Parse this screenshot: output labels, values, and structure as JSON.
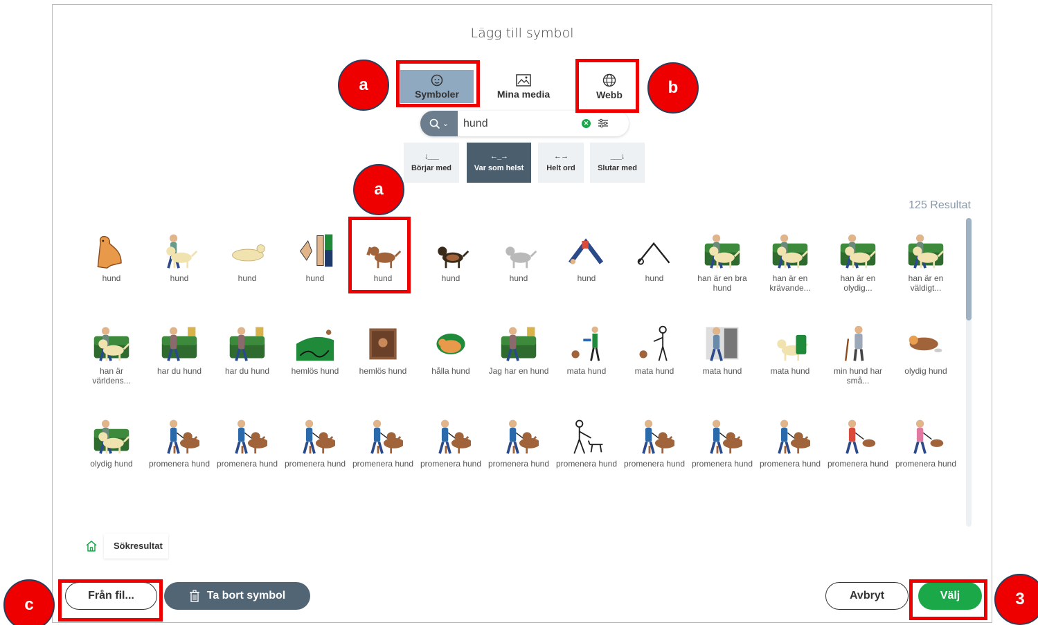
{
  "dialog": {
    "title": "Lägg till symbol"
  },
  "tabs": [
    {
      "label": "Symboler",
      "icon": "face-icon",
      "active": true
    },
    {
      "label": "Mina media",
      "icon": "image-icon",
      "active": false
    },
    {
      "label": "Webb",
      "icon": "globe-icon",
      "active": false
    }
  ],
  "search": {
    "value": "hund",
    "placeholder": ""
  },
  "match_modes": [
    {
      "symbol": "↓___",
      "label": "Börjar med",
      "active": false
    },
    {
      "symbol": "←_→",
      "label": "Var som helst",
      "active": true
    },
    {
      "symbol": "←→",
      "label": "Helt ord",
      "active": false
    },
    {
      "symbol": "___↓",
      "label": "Slutar med",
      "active": false
    }
  ],
  "results": {
    "count_label": "125 Resultat",
    "items": [
      {
        "label": "hund",
        "kind": "dog-sitting"
      },
      {
        "label": "hund",
        "kind": "person-dog"
      },
      {
        "label": "hund",
        "kind": "dog-lying"
      },
      {
        "label": "hund",
        "kind": "sign"
      },
      {
        "label": "hund",
        "kind": "dog-standing"
      },
      {
        "label": "hund",
        "kind": "dog-black"
      },
      {
        "label": "hund",
        "kind": "dog-grey"
      },
      {
        "label": "hund",
        "kind": "yoga"
      },
      {
        "label": "hund",
        "kind": "yoga-line"
      },
      {
        "label": "han är en bra hund",
        "kind": "sofa"
      },
      {
        "label": "han är en krävande...",
        "kind": "sofa"
      },
      {
        "label": "han är en olydig...",
        "kind": "sofa"
      },
      {
        "label": "han är en väldigt...",
        "kind": "sofa"
      },
      {
        "label": "han är världens...",
        "kind": "sofa"
      },
      {
        "label": "har du hund",
        "kind": "sofa2"
      },
      {
        "label": "har du hund",
        "kind": "sofa2"
      },
      {
        "label": "hemlös hund",
        "kind": "field"
      },
      {
        "label": "hemlös hund",
        "kind": "box"
      },
      {
        "label": "hålla hund",
        "kind": "hold"
      },
      {
        "label": "Jag har en hund",
        "kind": "sofa2"
      },
      {
        "label": "mata hund",
        "kind": "feed"
      },
      {
        "label": "mata hund",
        "kind": "feed-line"
      },
      {
        "label": "mata hund",
        "kind": "kitchen"
      },
      {
        "label": "mata hund",
        "kind": "food"
      },
      {
        "label": "min hund har små...",
        "kind": "old-man"
      },
      {
        "label": "olydig hund",
        "kind": "dog-mess"
      },
      {
        "label": "olydig hund",
        "kind": "sofa"
      },
      {
        "label": "promenera hund",
        "kind": "walk"
      },
      {
        "label": "promenera hund",
        "kind": "walk"
      },
      {
        "label": "promenera hund",
        "kind": "walk"
      },
      {
        "label": "promenera hund",
        "kind": "walk"
      },
      {
        "label": "promenera hund",
        "kind": "walk"
      },
      {
        "label": "promenera hund",
        "kind": "walk"
      },
      {
        "label": "promenera hund",
        "kind": "walk-line"
      },
      {
        "label": "promenera hund",
        "kind": "walk"
      },
      {
        "label": "promenera hund",
        "kind": "walk"
      },
      {
        "label": "promenera hund",
        "kind": "walk"
      },
      {
        "label": "promenera hund",
        "kind": "walk-red"
      },
      {
        "label": "promenera hund",
        "kind": "walk-pink"
      },
      {
        "label": "",
        "kind": "partial"
      },
      {
        "label": "",
        "kind": "partial"
      },
      {
        "label": "",
        "kind": "partial"
      },
      {
        "label": "",
        "kind": "partial"
      },
      {
        "label": "",
        "kind": "partial"
      },
      {
        "label": "",
        "kind": "partial"
      },
      {
        "label": "",
        "kind": "partial"
      },
      {
        "label": "",
        "kind": "partial"
      },
      {
        "label": "",
        "kind": "partial"
      },
      {
        "label": "",
        "kind": "partial"
      },
      {
        "label": "",
        "kind": "partial"
      },
      {
        "label": "",
        "kind": "partial"
      },
      {
        "label": "",
        "kind": "partial"
      }
    ]
  },
  "breadcrumb": {
    "home_icon": "home-icon",
    "current": "Sökresultat"
  },
  "footer": {
    "from_file": "Från fil...",
    "delete": "Ta bort symbol",
    "cancel": "Avbryt",
    "choose": "Välj"
  },
  "annotations": {
    "badge_a_top": "a",
    "badge_b": "b",
    "badge_a_mid": "a",
    "badge_c": "c",
    "badge_3": "3",
    "color": "#ee0000"
  },
  "colors": {
    "accent_green": "#1aa849",
    "active_tab": "#8fa9c1",
    "dark_slate": "#4b5e6e"
  }
}
